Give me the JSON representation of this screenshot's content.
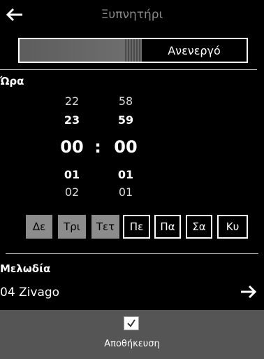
{
  "header": {
    "title": "Ξυπνητήρι",
    "back_icon": "back-arrow-icon"
  },
  "toggle": {
    "state_label": "Ανενεργό"
  },
  "time": {
    "section_label": "Ώρα",
    "hours_prev2": "22",
    "hours_prev1": "23",
    "hours_current": "00",
    "hours_next1": "01",
    "hours_next2": "02",
    "separator": ":",
    "minutes_prev2": "58",
    "minutes_prev1": "59",
    "minutes_current": "00",
    "minutes_next1": "01",
    "minutes_next2": "01"
  },
  "days": [
    {
      "label": "Δε",
      "active": true
    },
    {
      "label": "Τρι",
      "active": true
    },
    {
      "label": "Τετ",
      "active": true
    },
    {
      "label": "Πε",
      "active": false
    },
    {
      "label": "Πα",
      "active": false
    },
    {
      "label": "Σα",
      "active": false
    },
    {
      "label": "Κυ",
      "active": false
    }
  ],
  "melody": {
    "section_label": "Μελωδία",
    "value": "04 Zivago",
    "next_icon": "right-arrow-icon"
  },
  "footer": {
    "save_label": "Αποθήκευση",
    "save_icon": "checkmark-icon"
  },
  "colors": {
    "background": "#000000",
    "footer": "#555555",
    "active_day": "#8c8c8c",
    "title": "#8a8a8a"
  }
}
